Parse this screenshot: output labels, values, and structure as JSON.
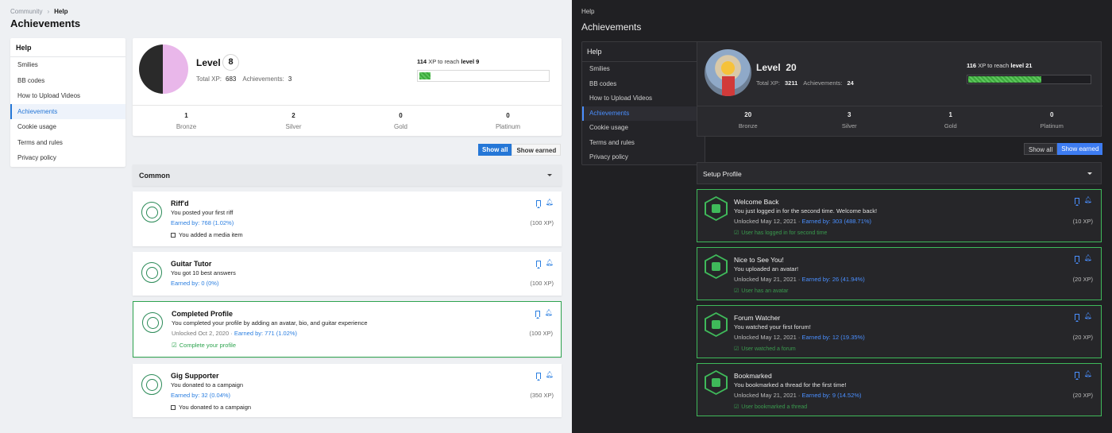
{
  "light": {
    "breadcrumb": {
      "root": "Community",
      "current": "Help"
    },
    "page_title": "Achievements",
    "sidebar": {
      "header": "Help",
      "items": [
        {
          "label": "Smilies"
        },
        {
          "label": "BB codes"
        },
        {
          "label": "How to Upload Videos"
        },
        {
          "label": "Achievements",
          "active": true
        },
        {
          "label": "Cookie usage"
        },
        {
          "label": "Terms and rules"
        },
        {
          "label": "Privacy policy"
        }
      ]
    },
    "profile": {
      "level_label": "Level",
      "level": "8",
      "total_xp_label": "Total XP:",
      "total_xp": "683",
      "achievements_label": "Achievements:",
      "achievements": "3",
      "xp_needed": "114",
      "xp_mid": "XP to reach",
      "next_level": "level 9",
      "progress_fraction": 0.09,
      "medals": [
        {
          "value": "1",
          "label": "Bronze"
        },
        {
          "value": "2",
          "label": "Silver"
        },
        {
          "value": "0",
          "label": "Gold"
        },
        {
          "value": "0",
          "label": "Platinum"
        }
      ]
    },
    "filter": {
      "show_all": "Show all",
      "show_earned": "Show earned",
      "active": "show_all"
    },
    "category": "Common",
    "achievements": [
      {
        "name": "Riff'd",
        "desc": "You posted your first riff",
        "unlocked": "",
        "earned": "Earned by: 768 (1.02%)",
        "xp": "(100 XP)",
        "criteria": "You added a media item",
        "complete": false
      },
      {
        "name": "Guitar Tutor",
        "desc": "You got 10 best answers",
        "unlocked": "",
        "earned": "Earned by: 0 (0%)",
        "xp": "(100 XP)",
        "criteria": "",
        "complete": false
      },
      {
        "name": "Completed Profile",
        "desc": "You completed your profile by adding an avatar, bio, and guitar experience",
        "unlocked": "Unlocked Oct 2, 2020",
        "earned": "Earned by: 771 (1.02%)",
        "xp": "(100 XP)",
        "criteria": "Complete your profile",
        "complete": true
      },
      {
        "name": "Gig Supporter",
        "desc": "You donated to a campaign",
        "unlocked": "",
        "earned": "Earned by: 32 (0.04%)",
        "xp": "(350 XP)",
        "criteria": "You donated to a campaign",
        "complete": false
      }
    ]
  },
  "dark": {
    "breadcrumb": {
      "current": "Help"
    },
    "page_title": "Achievements",
    "sidebar": {
      "header": "Help",
      "items": [
        {
          "label": "Smilies"
        },
        {
          "label": "BB codes"
        },
        {
          "label": "How to Upload Videos"
        },
        {
          "label": "Achievements",
          "active": true
        },
        {
          "label": "Cookie usage"
        },
        {
          "label": "Terms and rules"
        },
        {
          "label": "Privacy policy"
        }
      ]
    },
    "profile": {
      "level_label": "Level",
      "level": "20",
      "total_xp_label": "Total XP:",
      "total_xp": "3211",
      "achievements_label": "Achievements:",
      "achievements": "24",
      "xp_needed": "116",
      "xp_mid": "XP to reach",
      "next_level": "level 21",
      "progress_fraction": 0.61,
      "medals": [
        {
          "value": "20",
          "label": "Bronze"
        },
        {
          "value": "3",
          "label": "Silver"
        },
        {
          "value": "1",
          "label": "Gold"
        },
        {
          "value": "0",
          "label": "Platinum"
        }
      ]
    },
    "filter": {
      "show_all": "Show all",
      "show_earned": "Show earned",
      "active": "show_earned"
    },
    "category": "Setup Profile",
    "achievements": [
      {
        "name": "Welcome Back",
        "desc": "You just logged in for the second time. Welcome back!",
        "unlocked": "Unlocked May 12, 2021",
        "earned": "Earned by: 303 (488.71%)",
        "xp": "(10 XP)",
        "criteria": "User has logged in for second time"
      },
      {
        "name": "Nice to See You!",
        "desc": "You uploaded an avatar!",
        "unlocked": "Unlocked May 21, 2021",
        "earned": "Earned by: 26 (41.94%)",
        "xp": "(20 XP)",
        "criteria": "User has an avatar"
      },
      {
        "name": "Forum Watcher",
        "desc": "You watched your first forum!",
        "unlocked": "Unlocked May 12, 2021",
        "earned": "Earned by: 12 (19.35%)",
        "xp": "(20 XP)",
        "criteria": "User watched a forum"
      },
      {
        "name": "Bookmarked",
        "desc": "You bookmarked a thread for the first time!",
        "unlocked": "Unlocked May 21, 2021",
        "earned": "Earned by: 9 (14.52%)",
        "xp": "(20 XP)",
        "criteria": "User bookmarked a thread"
      }
    ]
  },
  "colors": {
    "accent_light": "#2577d7",
    "accent_dark": "#4a8fff",
    "success": "#2ea44f",
    "progress": "#4cb84c"
  },
  "icons": [
    "chevron-right-icon",
    "caret-down-icon",
    "bookmark-icon",
    "bell-icon",
    "checkbox-icon",
    "check-icon",
    "achievement-badge-icon"
  ]
}
